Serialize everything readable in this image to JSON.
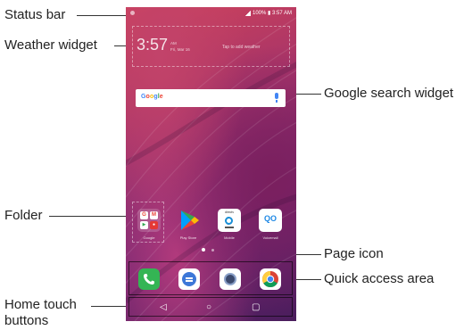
{
  "callouts": {
    "status_bar": "Status bar",
    "weather_widget": "Weather widget",
    "google_search_widget": "Google search widget",
    "folder": "Folder",
    "page_icon": "Page icon",
    "quick_access_area": "Quick access area",
    "home_touch_buttons_line1": "Home touch",
    "home_touch_buttons_line2": "buttons"
  },
  "status": {
    "battery_time": "100% ▮ 3:57 AM"
  },
  "weather": {
    "time": "3:57",
    "am": "AM",
    "date": "Fri, Mar 16",
    "tap_text": "Tap to add weather"
  },
  "search": {
    "logo": "Google"
  },
  "folder": {
    "mini": [
      "G",
      "M",
      "▶",
      "●"
    ]
  },
  "apps": [
    {
      "label": "Google"
    },
    {
      "label": "Play Store"
    },
    {
      "label": "Mobile",
      "badge": "directv"
    },
    {
      "label": "Voicemail",
      "glyph": "QO"
    }
  ],
  "nav": {
    "back": "◁",
    "home": "○",
    "recents": "▢"
  },
  "colors": {
    "wallpaper_top": "#d0435a",
    "wallpaper_bottom": "#4a1d5c",
    "phone_green": "#34b554",
    "messages_blue": "#3d78d8",
    "voicemail_blue": "#1e88e5"
  }
}
